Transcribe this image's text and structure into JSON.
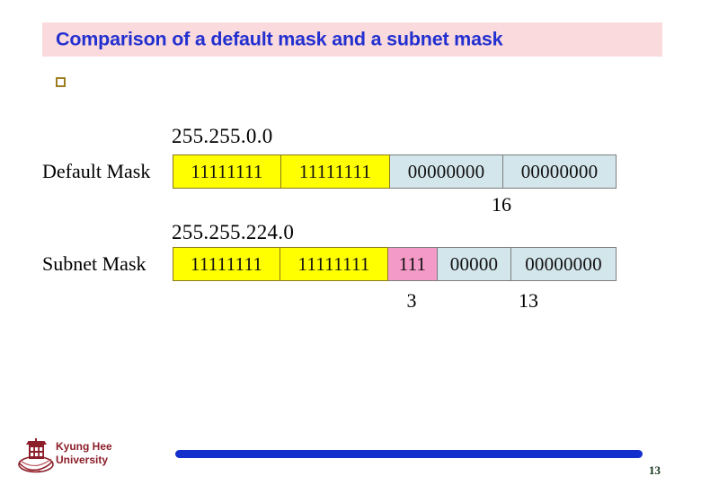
{
  "slide": {
    "title": "Comparison of a default mask and a subnet mask",
    "title_bg": "#fadadd",
    "title_color": "#2330d0",
    "bullet_icon": "hollow-square-bullet",
    "bullet_color": "#9c7d20"
  },
  "diagram": {
    "rows": [
      {
        "dotted_value": "255.255.0.0",
        "label": "Default Mask",
        "segments": [
          {
            "text": "11111111",
            "color": "#ffff00",
            "kind": "yellow"
          },
          {
            "text": "11111111",
            "color": "#ffff00",
            "kind": "yellow"
          },
          {
            "text": "00000000",
            "color": "#d3e6ec",
            "kind": "blue"
          },
          {
            "text": "00000000",
            "color": "#d3e6ec",
            "kind": "blue"
          }
        ],
        "counts": [
          {
            "value": "16",
            "meaning": "host-bits-count"
          }
        ]
      },
      {
        "dotted_value": "255.255.224.0",
        "label": "Subnet Mask",
        "segments": [
          {
            "text": "11111111",
            "color": "#ffff00",
            "kind": "yellow"
          },
          {
            "text": "11111111",
            "color": "#ffff00",
            "kind": "yellow"
          },
          {
            "text": "111",
            "color": "#f49ac8",
            "kind": "pink"
          },
          {
            "text": "00000",
            "color": "#d3e6ec",
            "kind": "blue"
          },
          {
            "text": "00000000",
            "color": "#d3e6ec",
            "kind": "blue"
          }
        ],
        "counts": [
          {
            "value": "3",
            "meaning": "subnet-bits-count"
          },
          {
            "value": "13",
            "meaning": "host-bits-count"
          }
        ]
      }
    ]
  },
  "footer": {
    "logo_icon": "kyung-hee-university-crest",
    "university_line1": "Kyung Hee",
    "university_line2": "University",
    "university_color": "#8c1f2a",
    "rule_color": "#1430cc",
    "page_number": "13"
  }
}
